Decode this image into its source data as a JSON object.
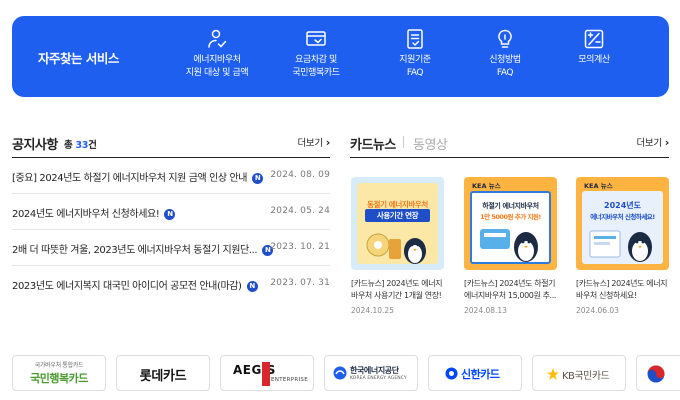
{
  "services": {
    "title": "자주찾는 서비스",
    "items": [
      {
        "line1": "에너지바우처",
        "line2": "지원 대상 및 금액",
        "icon": "person-check-icon"
      },
      {
        "line1": "요금차감 및",
        "line2": "국민행복카드",
        "icon": "card-icon"
      },
      {
        "line1": "지원기준",
        "line2": "FAQ",
        "icon": "document-check-icon"
      },
      {
        "line1": "신청방법",
        "line2": "FAQ",
        "icon": "lightbulb-icon"
      },
      {
        "line1": "모의계산",
        "line2": "",
        "icon": "calculator-icon"
      }
    ]
  },
  "notice": {
    "title": "공지사항",
    "count_prefix": "총 ",
    "count": "33",
    "count_suffix": "건",
    "more": "더보기",
    "new_badge": "N",
    "items": [
      {
        "title": "[중요] 2024년도 하절기 에너지바우처 지원 금액 인상 안내",
        "date": "2024. 08. 09"
      },
      {
        "title": "2024년도 에너지바우처 신청하세요!",
        "date": "2024. 05. 24"
      },
      {
        "title": "2배 더 따뜻한 겨울, 2023년도 에너지바우처 동절기 지원단...",
        "date": "2023. 10. 21"
      },
      {
        "title": "2023년도 에너지복지 대국민 아이디어 공모전 안내(마감)",
        "date": "2023. 07. 31"
      }
    ]
  },
  "news": {
    "tab_active": "카드뉴스",
    "tab_inactive": "동영상",
    "more": "더보기",
    "cards": [
      {
        "line1": "[카드뉴스] 2024년도 에너지",
        "line2": "바우처 사용기간 1개월 연장!",
        "date": "2024.10.25",
        "thumb_heading": "동절기 에너지바우처",
        "thumb_sub": "사용기간 연장",
        "bg": "#fbe7a6",
        "frame": "#d7ecf8"
      },
      {
        "line1": "[카드뉴스] 2024년도 하절기",
        "line2": "에너지바우처 15,000원 추...",
        "date": "2024.08.13",
        "thumb_heading": "하절기 에너지바우처",
        "thumb_sub": "1만 5000원 추가 지원!",
        "bg": "#ffb340",
        "frame": "#2d7be0"
      },
      {
        "line1": "[카드뉴스] 2024년도 에너지",
        "line2": "바우처 신청하세요!",
        "date": "2024.06.03",
        "thumb_heading": "2024년도",
        "thumb_sub": "에너지바우처 신청하세요!",
        "bg": "#ffb340",
        "frame": "#e8f1fb"
      }
    ],
    "thumb_brand": "KEA 뉴스"
  },
  "partners": {
    "items": [
      {
        "top": "국가바우처 통합카드",
        "main": "국민행복카드"
      },
      {
        "main": "롯데카드"
      },
      {
        "main": "AEGIS",
        "sub": "ENTERPRISE"
      },
      {
        "main": "한국에너지공단",
        "sub": "KOREA ENERGY AGENCY"
      },
      {
        "main": "신한카드"
      },
      {
        "main": "KB국민카드"
      }
    ]
  },
  "colors": {
    "accent": "#1f5ff0",
    "badge": "#1f4fc8"
  }
}
